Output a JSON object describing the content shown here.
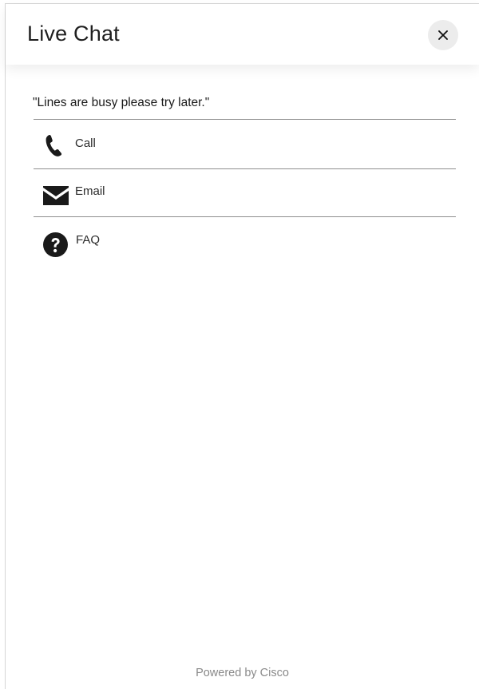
{
  "header": {
    "title": "Live Chat",
    "close_icon": "close-icon"
  },
  "main": {
    "status_message": "\"Lines are busy please try later.\"",
    "options": [
      {
        "label": "Call",
        "icon": "phone-icon"
      },
      {
        "label": "Email",
        "icon": "envelope-icon"
      },
      {
        "label": "FAQ",
        "icon": "question-circle-icon"
      }
    ]
  },
  "footer": {
    "text": "Powered by Cisco"
  },
  "colors": {
    "icon": "#1a1a1a",
    "divider": "#8f8f8f",
    "close_bg": "#ececec",
    "footer_text": "#8a8a8a"
  }
}
